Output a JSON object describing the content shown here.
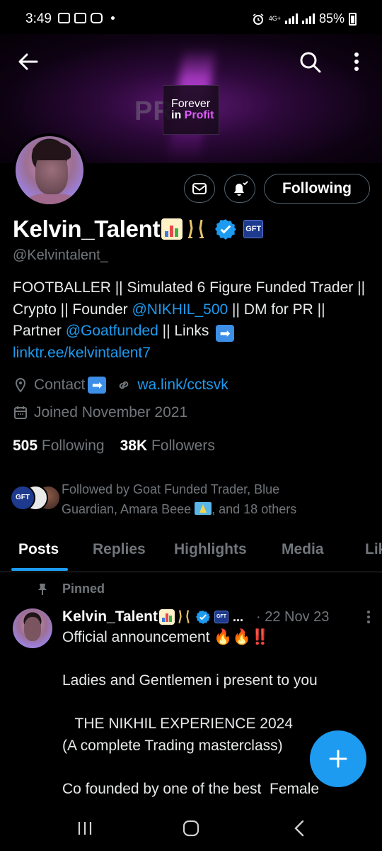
{
  "status_bar": {
    "time": "3:49",
    "network": "4G+",
    "battery": "85%"
  },
  "banner": {
    "ghost_text": "PR  IT",
    "line1": "Forever",
    "line2_prefix": "in ",
    "line2_accent": "Profit"
  },
  "header_actions": {
    "following_label": "Following"
  },
  "profile": {
    "display_name": "Kelvin_Talent",
    "affiliate_badge": "GFT",
    "handle": "@Kelvintalent_",
    "bio": {
      "part1": "FOOTBALLER || Simulated 6 Figure Funded Trader || Crypto || Founder ",
      "mention1": "@NIKHIL_500",
      "part2": " || DM for PR || Partner ",
      "mention2": "@Goatfunded",
      "part3": " || Links ",
      "arrow": "➡",
      "link": "linktr.ee/kelvintalent7"
    },
    "contact_label": "Contact",
    "contact_arrow": "➡",
    "website": "wa.link/cctsvk",
    "joined": "Joined November 2021",
    "following_count": "505",
    "following_label": "Following",
    "followers_count": "38K",
    "followers_label": "Followers",
    "followed_by_1": "Followed by Goat Funded Trader, Blue",
    "followed_by_2": "Guardian, Amara Beee",
    "followed_by_3": ", and 18 others"
  },
  "tabs": [
    {
      "label": "Posts",
      "active": true
    },
    {
      "label": "Replies"
    },
    {
      "label": "Highlights"
    },
    {
      "label": "Media"
    },
    {
      "label": "Lik"
    }
  ],
  "tweet": {
    "pinned_label": "Pinned",
    "author": "Kelvin_Talent",
    "ellipsis": "...",
    "date": "· 22 Nov 23",
    "line1": "Official announcement 🔥🔥‼️",
    "line2": "",
    "line3": "Ladies and Gentlemen i present to you",
    "line4": "",
    "line5": "   THE NIKHIL EXPERIENCE 2024",
    "line6": "(A complete Trading masterclass)",
    "line7": "",
    "line8": "Co founded by one of the best  Female"
  },
  "colors": {
    "accent": "#1d9bf0",
    "muted": "#71767b",
    "text": "#e7e9ea",
    "border": "#536471",
    "background": "#000000"
  }
}
